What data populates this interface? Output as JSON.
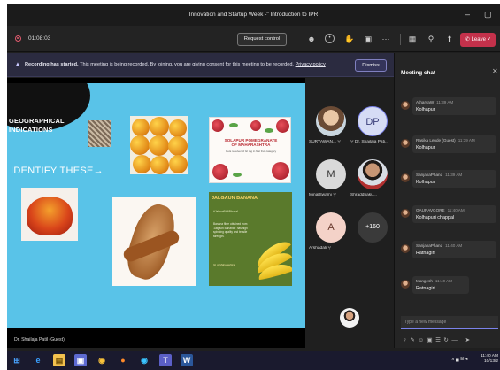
{
  "window": {
    "title": "Innovation and Startup Week -\" Introduction to IPR",
    "minimize": "–",
    "maximize": "▢"
  },
  "toolbar": {
    "timer": "01:08:03",
    "request_control": "Request control",
    "leave_label": "Leave",
    "icons": [
      "participants-icon",
      "chat-icon",
      "reactions-icon",
      "rooms-icon",
      "more-icon",
      "camera-icon",
      "mic-icon",
      "share-icon"
    ]
  },
  "banner": {
    "bold": "Recording has started.",
    "text": "This meeting is being recorded. By joining, you are giving consent for this meeting to be recorded.",
    "link": "Privacy policy",
    "dismiss": "Dismiss"
  },
  "slide": {
    "heading_line1": "GEOGRAPHICAL",
    "heading_line2": "INDICATIONS",
    "identify": "IDENTIFY THESE→",
    "pomegranate_title": "SOLAPUR POMEGRANATE OF MAHARASHTRA",
    "pomegranate_sub": "Gets receiver of GI tag in first fruit category",
    "banana_title": "JALGAUN BANANA",
    "banana_sub": "#JalaonBhiliBhusal",
    "banana_body": "Banana fibre obtained from 'Jalgaon Bananas' has high spinning quality and tensile strength.",
    "banana_foot": "GI of Maharashtra"
  },
  "presenter": "Dr. Shailaja Patil (Guest)",
  "participants": [
    {
      "name": "SURYAWAN...",
      "initials": "",
      "color": ""
    },
    {
      "name": "Dr. Shailaja Pati...",
      "initials": "DP",
      "color": "#d6dcf5"
    },
    {
      "name": "MinalSwami",
      "initials": "M",
      "color": "#d9d9d9"
    },
    {
      "name": "Shraddhaku...",
      "initials": "",
      "color": ""
    },
    {
      "name": "Arshadali",
      "initials": "A",
      "color": "#f4d2c8"
    },
    {
      "name": "",
      "initials": "+160",
      "color": "#3a3a3a"
    }
  ],
  "chat": {
    "title": "Meeting chat",
    "messages": [
      {
        "sender": "AtharvaW",
        "time": "11:39 AM",
        "text": "Kolhapur"
      },
      {
        "sender": "Rasika Lende (Guest)",
        "time": "11:39 AM",
        "text": "Kolhapur"
      },
      {
        "sender": "SanjanaPhand",
        "time": "11:39 AM",
        "text": "Kolhapur"
      },
      {
        "sender": "GAURAVGORE",
        "time": "11:40 AM",
        "text": "Kolhapuri chappal"
      },
      {
        "sender": "SanjanaPhand",
        "time": "11:40 AM",
        "text": "Ratnagiri"
      },
      {
        "sender": "Mangesh",
        "time": "11:40 AM",
        "text": "Ratnagiri"
      }
    ],
    "compose_placeholder": "Type a new message",
    "compose_tools": "♀✎☺▣☰↻—  ➤"
  },
  "taskbar": {
    "clock_time": "11:40 AM",
    "clock_date": "10/13/2",
    "tray": "∧ ▄ ☱ ◂"
  }
}
